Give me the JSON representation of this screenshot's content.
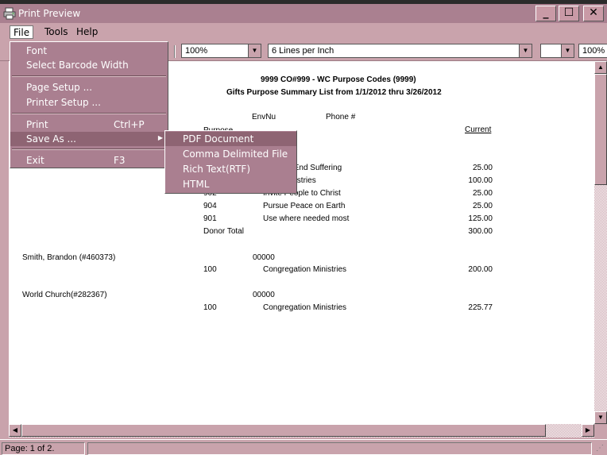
{
  "window": {
    "title": "Print Preview",
    "minimize_label": "_",
    "maximize_label": "☐",
    "close_label": "✕"
  },
  "menubar": {
    "items": [
      "File",
      "Tools",
      "Help"
    ]
  },
  "toolbar": {
    "zoom_value": "100%",
    "lines_value": "6 Lines per Inch",
    "blank_value": "",
    "zoom2_value": "100%"
  },
  "file_menu": {
    "items": [
      {
        "label": "Font",
        "shortcut": ""
      },
      {
        "label": "Select Barcode Width",
        "shortcut": ""
      },
      {
        "label": "Page Setup ...",
        "shortcut": ""
      },
      {
        "label": "Printer Setup ...",
        "shortcut": ""
      },
      {
        "label": "Print",
        "shortcut": "Ctrl+P"
      },
      {
        "label": "Save As ...",
        "shortcut": ""
      },
      {
        "label": "Exit",
        "shortcut": "F3"
      }
    ],
    "highlighted": "Save As ..."
  },
  "save_as_submenu": {
    "items": [
      "PDF Document",
      "Comma Delimited File",
      "Rich Text(RTF)",
      "HTML"
    ],
    "highlighted": "PDF Document"
  },
  "report": {
    "title_line1": "9999 CO#999 - WC Purpose Codes (9999)",
    "title_line2": "Gifts Purpose Summary List from 1/1/2012 thru 3/26/2012",
    "col_envnu": "EnvNu",
    "col_phone": "Phone #",
    "col_purpose": "Purpose",
    "col_current": "Current",
    "partial_rows": [
      {
        "code": "",
        "desc": "Poverty, End Suffering",
        "amount": "25.00"
      },
      {
        "code": "",
        "desc": "ation Ministries",
        "amount": "100.00"
      },
      {
        "code": "902",
        "desc": "Invite People to Christ",
        "amount": "25.00"
      }
    ],
    "rows": [
      {
        "code": "904",
        "desc": "Pursue Peace on Earth",
        "amount": "25.00"
      },
      {
        "code": "901",
        "desc": "Use where needed most",
        "amount": "125.00"
      }
    ],
    "donor_total_label": "Donor Total",
    "donor_total_amount": "300.00",
    "donors": [
      {
        "name": "Smith, Brandon (#460373)",
        "env": "00000",
        "code": "100",
        "desc": "Congregation Ministries",
        "amount": "200.00"
      },
      {
        "name": "World Church(#282367)",
        "env": "00000",
        "code": "100",
        "desc": "Congregation Ministries",
        "amount": "225.77"
      }
    ]
  },
  "statusbar": {
    "page_text": "Page: 1 of 2."
  }
}
